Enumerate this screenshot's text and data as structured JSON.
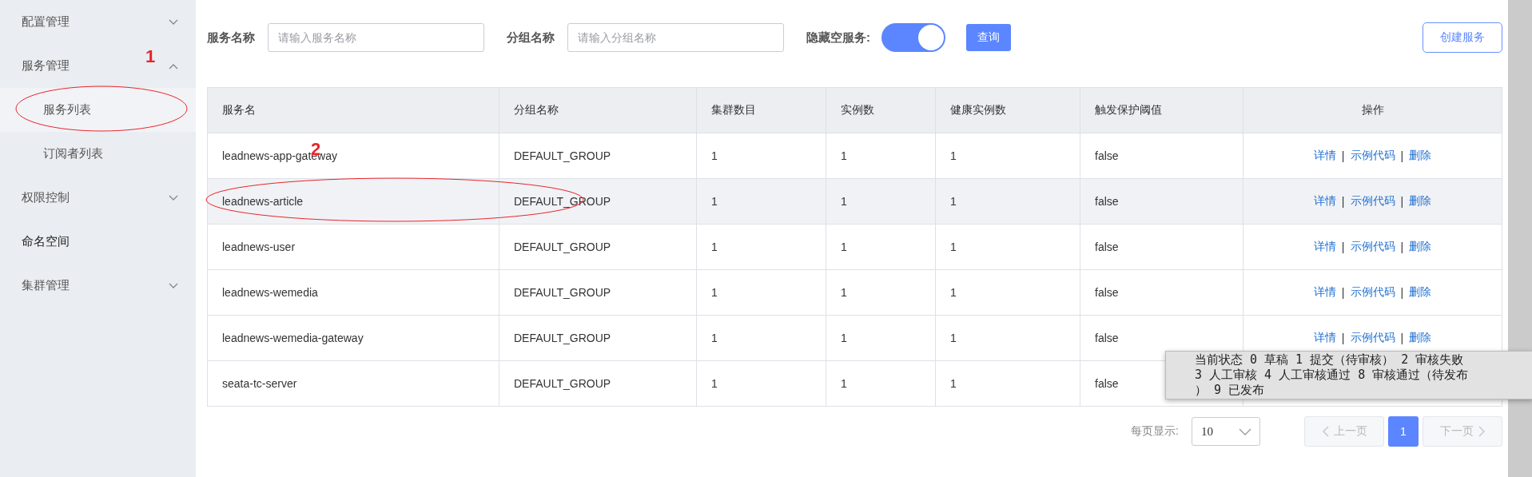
{
  "sidebar": {
    "items": [
      {
        "label": "配置管理",
        "expanded": false
      },
      {
        "label": "服务管理",
        "expanded": true,
        "children": [
          {
            "label": "服务列表",
            "selected": true
          },
          {
            "label": "订阅者列表",
            "selected": false
          }
        ]
      },
      {
        "label": "权限控制",
        "expanded": false
      },
      {
        "label": "命名空间"
      },
      {
        "label": "集群管理",
        "expanded": false
      }
    ]
  },
  "filters": {
    "service_name": {
      "label": "服务名称",
      "placeholder": "请输入服务名称"
    },
    "group_name": {
      "label": "分组名称",
      "placeholder": "请输入分组名称"
    },
    "hide_empty": {
      "label": "隐藏空服务:",
      "on": true
    },
    "query_button": "查询",
    "create_button": "创建服务"
  },
  "table": {
    "columns": [
      "服务名",
      "分组名称",
      "集群数目",
      "实例数",
      "健康实例数",
      "触发保护阈值",
      "操作"
    ],
    "rows": [
      {
        "cells": [
          "leadnews-app-gateway",
          "DEFAULT_GROUP",
          "1",
          "1",
          "1",
          "false"
        ],
        "actions": [
          {
            "kind": "link",
            "text": "详情"
          },
          {
            "kind": "separator",
            "text": "|"
          },
          {
            "kind": "link",
            "text": "示例代码"
          },
          {
            "kind": "separator",
            "text": "|"
          },
          {
            "kind": "link",
            "text": "删除"
          }
        ],
        "highlighted": false
      },
      {
        "cells": [
          "leadnews-article",
          "DEFAULT_GROUP",
          "1",
          "1",
          "1",
          "false"
        ],
        "actions": [
          {
            "kind": "link",
            "text": "详情"
          },
          {
            "kind": "separator",
            "text": "|"
          },
          {
            "kind": "link",
            "text": "示例代码"
          },
          {
            "kind": "separator",
            "text": "|"
          },
          {
            "kind": "link",
            "text": "删除"
          }
        ],
        "highlighted": true
      },
      {
        "cells": [
          "leadnews-user",
          "DEFAULT_GROUP",
          "1",
          "1",
          "1",
          "false"
        ],
        "actions": [
          {
            "kind": "link",
            "text": "详情"
          },
          {
            "kind": "separator",
            "text": "|"
          },
          {
            "kind": "link",
            "text": "示例代码"
          },
          {
            "kind": "separator",
            "text": "|"
          },
          {
            "kind": "link",
            "text": "删除"
          }
        ],
        "highlighted": false
      },
      {
        "cells": [
          "leadnews-wemedia",
          "DEFAULT_GROUP",
          "1",
          "1",
          "1",
          "false"
        ],
        "actions": [
          {
            "kind": "link",
            "text": "详情"
          },
          {
            "kind": "separator",
            "text": "|"
          },
          {
            "kind": "link",
            "text": "示例代码"
          },
          {
            "kind": "separator",
            "text": "|"
          },
          {
            "kind": "link",
            "text": "删除"
          }
        ],
        "highlighted": false
      },
      {
        "cells": [
          "leadnews-wemedia-gateway",
          "DEFAULT_GROUP",
          "1",
          "1",
          "1",
          "false"
        ],
        "actions": [
          {
            "kind": "link",
            "text": "详情"
          },
          {
            "kind": "separator",
            "text": "|"
          },
          {
            "kind": "link",
            "text": "示例代码"
          },
          {
            "kind": "separator",
            "text": "|"
          },
          {
            "kind": "link",
            "text": "删除"
          }
        ],
        "highlighted": false
      },
      {
        "cells": [
          "seata-tc-server",
          "DEFAULT_GROUP",
          "1",
          "1",
          "1",
          "false"
        ],
        "highlighted": false
      }
    ]
  },
  "pagination": {
    "page_size_label": "每页显示:",
    "page_size": "10",
    "prev": "上一页",
    "pages": [
      {
        "label": "1",
        "selected": true
      }
    ],
    "next": "下一页"
  },
  "annotations": [
    {
      "text": "1"
    },
    {
      "text": "2"
    }
  ],
  "tooltip": {
    "lines": [
      "当前状态 0 草稿 1 提交（待审核） 2 审核失败",
      "3 人工审核 4 人工审核通过 8 审核通过（待发布",
      "） 9 已发布"
    ]
  }
}
